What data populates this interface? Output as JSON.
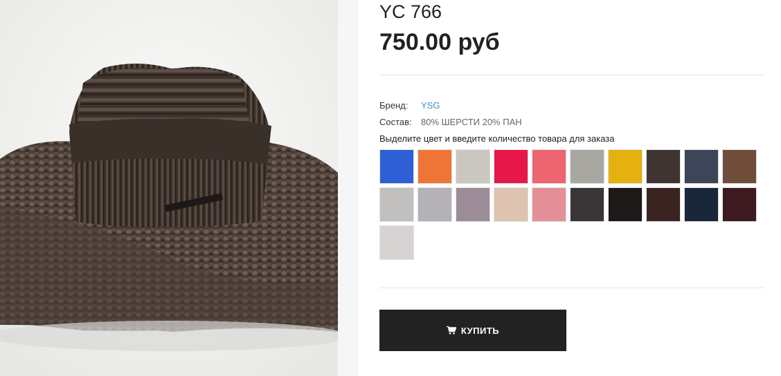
{
  "product": {
    "title": "YC 766",
    "price": "750.00 руб",
    "image_alt_icon": "knitted-hat-and-scarf-photo"
  },
  "attributes": {
    "brand_label": "Бренд:",
    "brand_value": "YSG",
    "composition_label": "Состав:",
    "composition_value": "80% ШЕРСТИ 20% ПАН"
  },
  "instruction": "Выделите цвет и введите количество товара для заказа",
  "swatches": [
    "#2f5fd6",
    "#ee7535",
    "#c9c7bf",
    "#e8174a",
    "#ec6570",
    "#a8a7a2",
    "#e5b10f",
    "#3e3432",
    "#3d4558",
    "#704c3b",
    "#c2bfbf",
    "#b4b1b7",
    "#9c8c98",
    "#dec3b1",
    "#e48f97",
    "#3a3536",
    "#1d1918",
    "#3a2421",
    "#1a263a",
    "#3d1b20",
    "#d8d3d3"
  ],
  "buy_button": {
    "label": "КУПИТЬ",
    "icon": "shopping-cart-icon"
  }
}
